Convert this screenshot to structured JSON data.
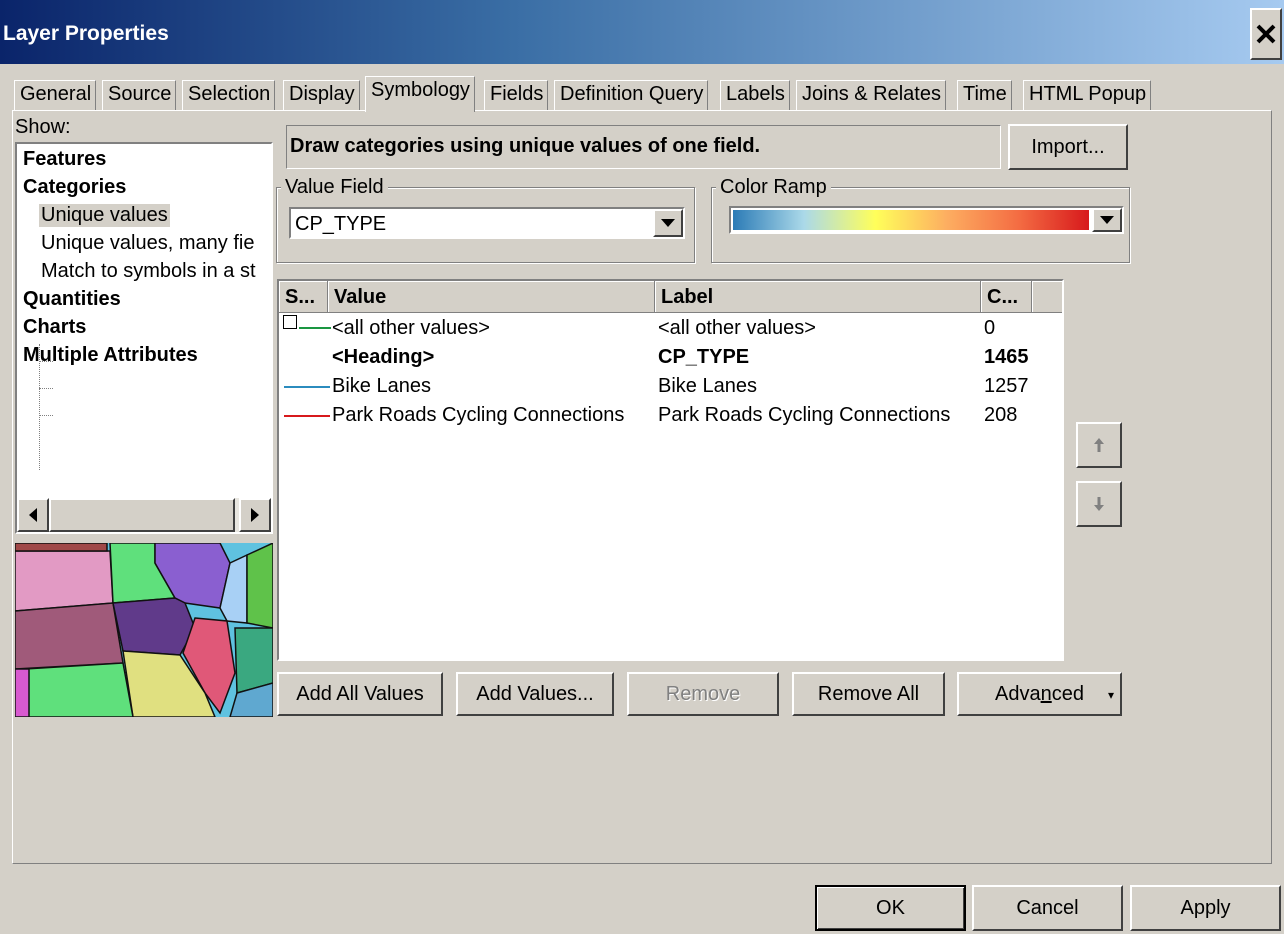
{
  "window": {
    "title": "Layer Properties"
  },
  "tabs": [
    "General",
    "Source",
    "Selection",
    "Display",
    "Symbology",
    "Fields",
    "Definition Query",
    "Labels",
    "Joins & Relates",
    "Time",
    "HTML Popup"
  ],
  "active_tab": "Symbology",
  "show": {
    "label": "Show:",
    "items": [
      {
        "label": "Features"
      },
      {
        "label": "Categories"
      },
      {
        "label": "Unique values"
      },
      {
        "label": "Unique values, many fie"
      },
      {
        "label": "Match to symbols in a st"
      },
      {
        "label": "Quantities"
      },
      {
        "label": "Charts"
      },
      {
        "label": "Multiple Attributes"
      }
    ],
    "selected": "Unique values"
  },
  "description": "Draw categories using unique values of one field.",
  "import_button": "Import...",
  "value_field": {
    "group_label": "Value Field",
    "value": "CP_TYPE"
  },
  "color_ramp": {
    "group_label": "Color Ramp",
    "colors": [
      "#2c7bb6",
      "#abd9e9",
      "#ffff5a",
      "#fdae61",
      "#f46d43",
      "#d7191c"
    ]
  },
  "grid": {
    "columns": [
      "S...",
      "Value",
      "Label",
      "C..."
    ],
    "rows": [
      {
        "value": "<all other values>",
        "label": "<all other values>",
        "count": "0",
        "symbol_color": "#1a9641",
        "bold": false
      },
      {
        "value": "<Heading>",
        "label": "CP_TYPE",
        "count": "1465",
        "symbol_color": "",
        "bold": true
      },
      {
        "value": "Bike Lanes",
        "label": "Bike Lanes",
        "count": "1257",
        "symbol_color": "#2b8cbe",
        "bold": false
      },
      {
        "value": "Park Roads Cycling Connections",
        "label": "Park Roads Cycling Connections",
        "count": "208",
        "symbol_color": "#d7191c",
        "bold": false
      }
    ]
  },
  "buttons": {
    "add_all": "Add All Values",
    "add_values": "Add Values...",
    "remove": "Remove",
    "remove_all": "Remove All",
    "advanced": "Advanced",
    "ok": "OK",
    "cancel": "Cancel",
    "apply": "Apply"
  },
  "icons": {
    "close": "close-icon",
    "move_up": "arrow-up-icon",
    "move_down": "arrow-down-icon",
    "dropdown": "chevron-down-icon"
  }
}
